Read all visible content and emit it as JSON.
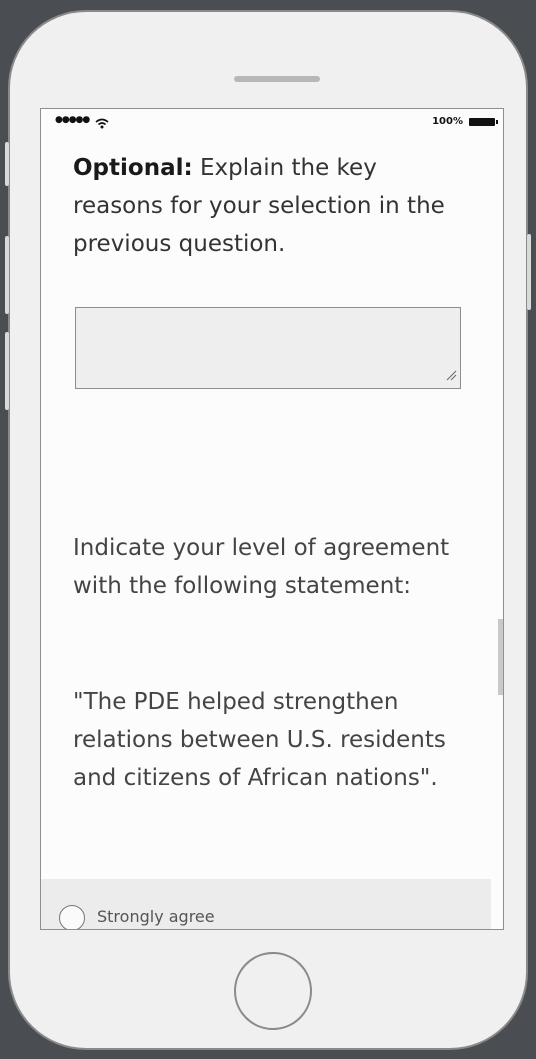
{
  "device": {
    "speaker_icon": "speaker-slot-icon",
    "home_button_icon": "home-button-circle-icon"
  },
  "status_bar": {
    "signal": "●●●●●",
    "wifi_icon": "wifi-icon",
    "battery_percent": "100%",
    "battery_icon": "battery-full-icon"
  },
  "questions": {
    "optional_label": "Optional:",
    "optional_text": "Explain the key reasons for your selection in the previous question.",
    "textarea_value": "",
    "agreement_prompt": "Indicate your level of agreement with the following statement:",
    "statement": "\"The PDE helped strengthen relations between U.S. residents and citizens of African nations\"."
  },
  "options": [
    {
      "label": "Strongly agree",
      "selected": false
    }
  ],
  "colors": {
    "background": "#4a4d52",
    "phone_body": "#f0f0f0",
    "screen": "#fcfcfc",
    "input_fill": "#eeeeee"
  }
}
